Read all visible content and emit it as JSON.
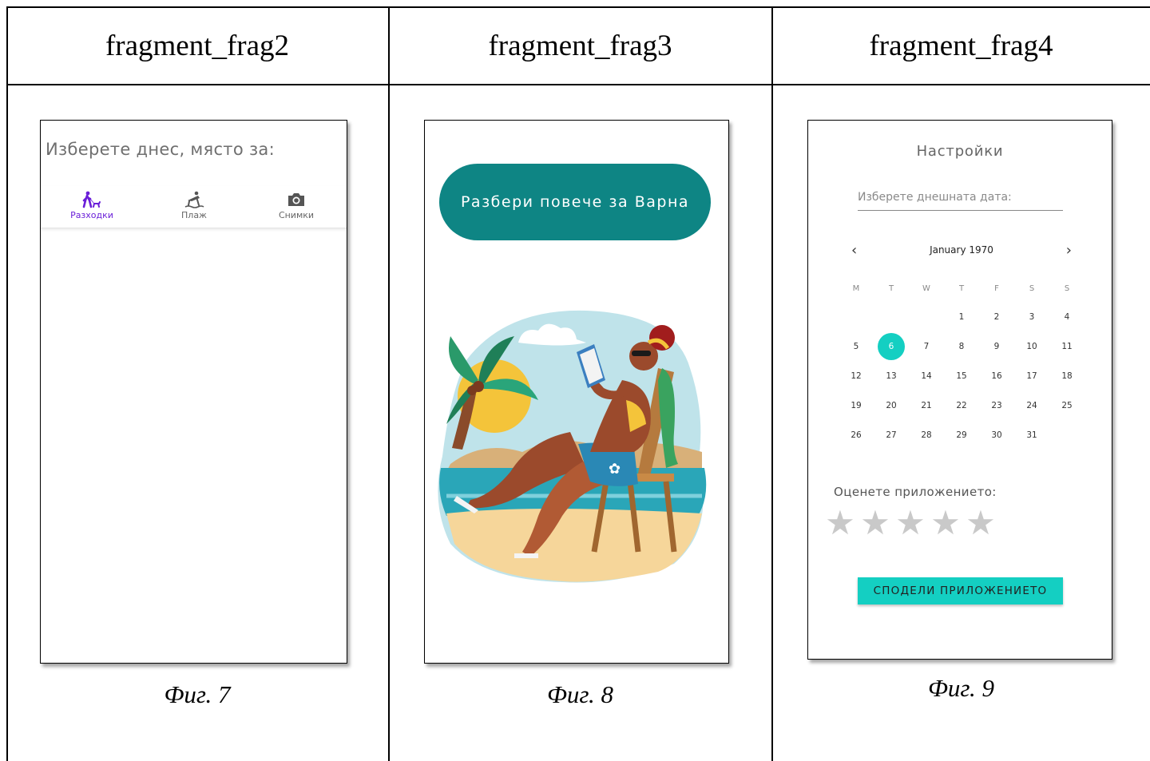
{
  "columns": [
    {
      "header": "fragment_frag2",
      "caption": "Фиг.  7",
      "screen": {
        "title": "Изберете днес, място за:",
        "nav_items": [
          {
            "label": "Разходки",
            "icon": "walk-icon",
            "active": true
          },
          {
            "label": "Плаж",
            "icon": "beach-icon",
            "active": false
          },
          {
            "label": "Снимки",
            "icon": "camera-icon",
            "active": false
          }
        ],
        "active_color": "#6a1ed8"
      }
    },
    {
      "header": "fragment_frag3",
      "caption": "Фиг.  8",
      "screen": {
        "button_label": "Разбери повече за Варна",
        "button_color": "#0e8584",
        "illustration": "woman-reading-on-beach-illustration"
      }
    },
    {
      "header": "fragment_frag4",
      "caption": "Фиг.  9",
      "screen": {
        "title": "Настройки",
        "date_placeholder": "Изберете днешната дата:",
        "calendar": {
          "month_label": "January 1970",
          "prev_icon": "chevron-left-icon",
          "next_icon": "chevron-right-icon",
          "weekdays": [
            "M",
            "T",
            "W",
            "T",
            "F",
            "S",
            "S"
          ],
          "weeks": [
            [
              "",
              "",
              "",
              "1",
              "2",
              "3",
              "4"
            ],
            [
              "5",
              "6",
              "7",
              "8",
              "9",
              "10",
              "11"
            ],
            [
              "12",
              "13",
              "14",
              "15",
              "16",
              "17",
              "18"
            ],
            [
              "19",
              "20",
              "21",
              "22",
              "23",
              "24",
              "25"
            ],
            [
              "26",
              "27",
              "28",
              "29",
              "30",
              "31",
              ""
            ]
          ],
          "selected_day": "6",
          "selected_color": "#14cfc2"
        },
        "rating_label": "Оценете приложението:",
        "rating_value": 0,
        "rating_max": 5,
        "share_label": "СПОДЕЛИ ПРИЛОЖЕНИЕТО",
        "share_color": "#14cfc2"
      }
    }
  ]
}
